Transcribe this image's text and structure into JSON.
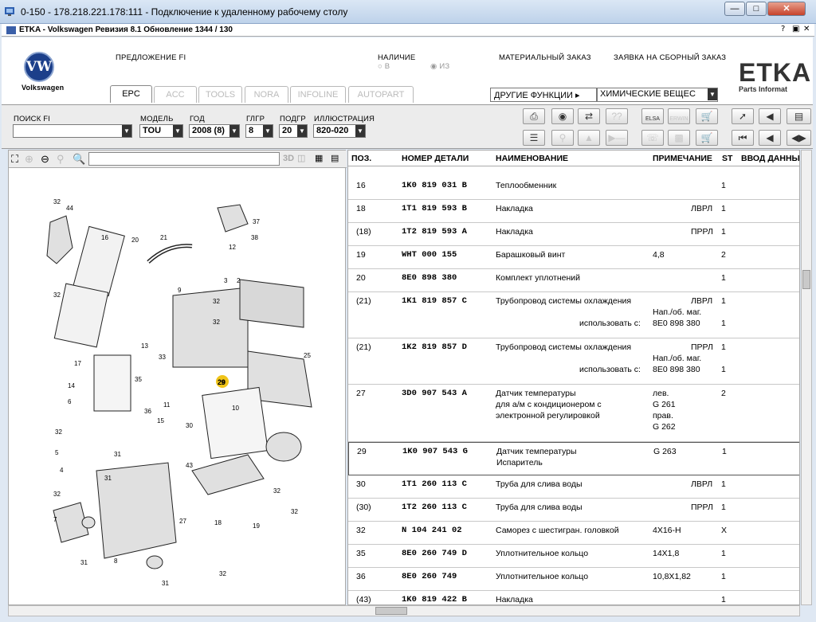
{
  "rd_title": "0-150 - 178.218.221.178:111 - Подключение к удаленному рабочему столу",
  "app_title": "ETKA - Volkswagen Ревизия 8.1 Обновление 1344 / 130",
  "brand": "Volkswagen",
  "logo_letters": "VW",
  "etka_logo": "ETKA",
  "etka_sub": "Parts Informat",
  "header": {
    "offer_fi": "ПРЕДЛОЖЕНИЕ FI",
    "stock": "НАЛИЧИЕ",
    "stock_opt_b": "В",
    "stock_opt_iz": "ИЗ",
    "material_order": "МАТЕРИАЛЬНЫЙ ЗАКАЗ",
    "assembly_order": "ЗАЯВКА НА СБОРНЫЙ ЗАКАЗ",
    "other_functions": "ДРУГИЕ ФУНКЦИИ ▸",
    "chemicals": "ХИМИЧЕСКИЕ ВЕЩЕС"
  },
  "tabs": [
    "EPC",
    "ACC",
    "TOOLS",
    "NORA",
    "INFOLINE",
    "AUTOPART"
  ],
  "filters": {
    "search_label": "ПОИСК FI",
    "search_value": "",
    "model_label": "МОДЕЛЬ",
    "model_value": "TOU",
    "year_label": "ГОД",
    "year_value": "2008 (8)",
    "hg_label": "ГЛГР",
    "hg_value": "8",
    "sg_label": "ПОДГР",
    "sg_value": "20",
    "ill_label": "ИЛЛЮСТРАЦИЯ",
    "ill_value": "820-020"
  },
  "toolbar_icons": [
    "printer-icon",
    "disc-icon",
    "car-arrows-icon",
    "question-icon",
    "elsa-icon",
    "erwin-icon",
    "cart-icon",
    "pin-icon",
    "back-doc-icon",
    "doc-icon",
    "list-icon",
    "key-icon",
    "car-icon",
    "play-icon",
    "phone-icon",
    "folder-icon",
    "cart-add-icon",
    "first-icon",
    "prev-icon",
    "next-icon"
  ],
  "elsa_text": "ELSA",
  "erwin_text": "ERWIN",
  "view3d": "3D",
  "columns": {
    "pos": "ПОЗ.",
    "part_no": "НОМЕР ДЕТАЛИ",
    "name": "НАИМЕНОВАНИЕ",
    "note": "ПРИМЕЧАНИЕ",
    "st": "ST",
    "input": "ВВОД ДАННЫ"
  },
  "rows": [
    {
      "pos": "16",
      "pn": "1K0  819  031  B",
      "name": "Теплообменник",
      "note": "",
      "note_r": "",
      "st": "1"
    },
    {
      "pos": "18",
      "pn": "1T1  819  593  B",
      "name": "Накладка",
      "note": "",
      "note_r": "ЛВРЛ",
      "st": "1"
    },
    {
      "pos": "(18)",
      "pn": "1T2  819  593  A",
      "name": "Накладка",
      "note": "",
      "note_r": "ПРРЛ",
      "st": "1"
    },
    {
      "pos": "19",
      "pn": "WHT  000  155",
      "name": "Барашковый винт",
      "note": "4,8",
      "note_r": "",
      "st": "2"
    },
    {
      "pos": "20",
      "pn": "8E0  898  380",
      "name": "Комплект уплотнений",
      "note": "",
      "note_r": "",
      "st": "1"
    },
    {
      "pos": "(21)",
      "pn": "1K1  819  857  C",
      "name": "Трубопровод системы охлаждения",
      "note": "Нап./об. маг.",
      "note_r": "ЛВРЛ",
      "st": "1",
      "use": "использовать с:",
      "use_val": "8E0 898 380",
      "st2": "1"
    },
    {
      "pos": "(21)",
      "pn": "1K2  819  857  D",
      "name": "Трубопровод системы охлаждения",
      "note": "Нап./об. маг.",
      "note_r": "ПРРЛ",
      "st": "1",
      "use": "использовать с:",
      "use_val": "8E0 898 380",
      "st2": "1"
    },
    {
      "pos": "27",
      "pn": "3D0  907  543  A",
      "name": "Датчик температуры",
      "name2": "для а/м с кондиционером с",
      "name3": "электронной регулировкой",
      "note": "лев.",
      "note2": "G 261",
      "note3": "прав.",
      "note4": "G 262",
      "st": "2"
    },
    {
      "pos": "29",
      "pn": "1K0  907  543  G",
      "name": "Датчик температуры",
      "name2": "Испаритель",
      "note": "G 263",
      "st": "1"
    },
    {
      "pos": "30",
      "pn": "1T1  260  113  C",
      "name": "Труба для слива воды",
      "note": "",
      "note_r": "ЛВРЛ",
      "st": "1"
    },
    {
      "pos": "(30)",
      "pn": "1T2  260  113  C",
      "name": "Труба для слива воды",
      "note": "",
      "note_r": "ПРРЛ",
      "st": "1"
    },
    {
      "pos": "32",
      "pn": "N    104  241  02",
      "name": "Саморез с шестигран. головкой",
      "note": "4X16-H",
      "note_r": "",
      "st": "X"
    },
    {
      "pos": "35",
      "pn": "8E0  260  749  D",
      "name": "Уплотнительное кольцо",
      "note": "14X1,8",
      "note_r": "",
      "st": "1"
    },
    {
      "pos": "36",
      "pn": "8E0  260  749",
      "name": "Уплотнительное кольцо",
      "note": "10,8X1,82",
      "note_r": "",
      "st": "1"
    },
    {
      "pos": "(43)",
      "pn": "1K0  819  422  B",
      "name": "Накладка",
      "note": "",
      "note_r": "",
      "st": "1"
    }
  ],
  "diagram_labels": [
    "32",
    "44",
    "16",
    "20",
    "21",
    "37",
    "38",
    "12",
    "32",
    "32",
    "9",
    "3",
    "2",
    "32",
    "25",
    "17",
    "13",
    "33",
    "14",
    "6",
    "35",
    "36",
    "11",
    "15",
    "29",
    "10",
    "30",
    "32",
    "5",
    "31",
    "4",
    "31",
    "43",
    "32",
    "32",
    "7",
    "27",
    "19",
    "18",
    "31",
    "8",
    "31",
    "32",
    "32"
  ],
  "highlight_label": "29"
}
